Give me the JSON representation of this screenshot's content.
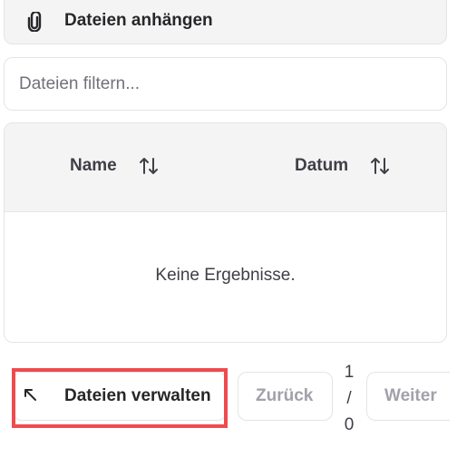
{
  "attach": {
    "label": "Dateien anhängen",
    "icon": "paperclip-icon"
  },
  "filter": {
    "placeholder": "Dateien filtern...",
    "value": ""
  },
  "table": {
    "columns": [
      {
        "label": "Name",
        "sort_icon": "sort-arrows-icon"
      },
      {
        "label": "Datum",
        "sort_icon": "sort-arrows-icon"
      }
    ],
    "empty_text": "Keine Ergebnisse."
  },
  "footer": {
    "manage_label": "Dateien verwalten",
    "manage_icon": "arrow-up-left-icon",
    "back_label": "Zurück",
    "next_label": "Weiter",
    "page_current": "1",
    "page_separator": "/",
    "page_total": "0"
  },
  "colors": {
    "highlight": "#ef4b4f",
    "muted_text": "#a1a1aa",
    "header_bg": "#f4f4f5"
  }
}
